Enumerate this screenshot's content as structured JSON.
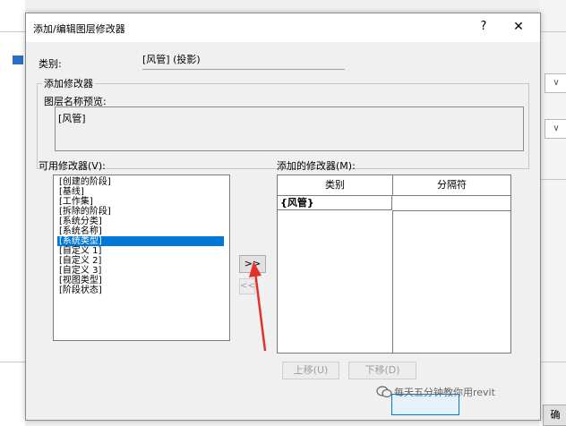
{
  "dialog": {
    "title": "添加/编辑图层修改器",
    "help_label": "?",
    "close_label": "✕",
    "category_label": "类别:",
    "category_value": "[风管] (投影)",
    "add_modifier_group": "添加修改器",
    "preview_label": "图层名称预览:",
    "preview_value": "[风管]",
    "available_label": "可用修改器(V):",
    "available_items": [
      {
        "label": "[创建的阶段]",
        "selected": false
      },
      {
        "label": "[基线]",
        "selected": false
      },
      {
        "label": "[工作集]",
        "selected": false
      },
      {
        "label": "[拆除的阶段]",
        "selected": false
      },
      {
        "label": "[系统分类]",
        "selected": false
      },
      {
        "label": "[系统名称]",
        "selected": false
      },
      {
        "label": "[系统类型]",
        "selected": true
      },
      {
        "label": "[自定义 1]",
        "selected": false
      },
      {
        "label": "[自定义 2]",
        "selected": false
      },
      {
        "label": "[自定义 3]",
        "selected": false
      },
      {
        "label": "[视图类型]",
        "selected": false
      },
      {
        "label": "[阶段状态]",
        "selected": false
      }
    ],
    "add_button": ">>",
    "remove_button": "<<",
    "added_label": "添加的修改器(M):",
    "added_columns": [
      "类别",
      "分隔符"
    ],
    "added_rows": [
      {
        "category": "{风管}",
        "separator": ""
      }
    ],
    "move_up": "上移(U)",
    "move_down": "下移(D)"
  },
  "background": {
    "right_button": "确"
  },
  "watermark": "每天五分钟教你用revit",
  "colors": {
    "selection": "#0078d7",
    "annotation_arrow": "#e0322a"
  }
}
